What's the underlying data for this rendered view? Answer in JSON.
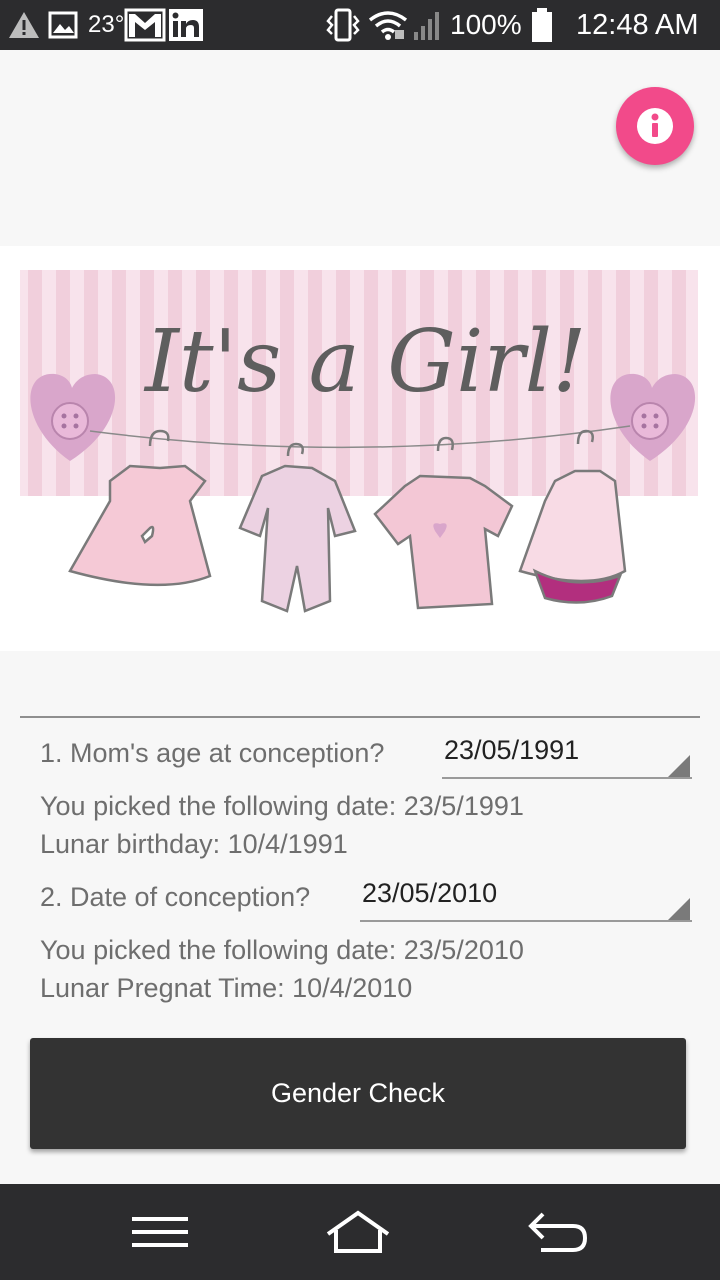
{
  "status_bar": {
    "temperature": "23°",
    "battery_percent": "100%",
    "time": "12:48 AM",
    "icons": [
      "warning-icon",
      "image-icon",
      "gmail-icon",
      "linkedin-icon",
      "vibrate-icon",
      "wifi-icon",
      "signal-icon",
      "battery-icon"
    ]
  },
  "info_button": {
    "icon": "info-icon",
    "color": "#f24a8a"
  },
  "banner": {
    "text": "It's a Girl!"
  },
  "form": {
    "q1": {
      "label": "1. Mom's age at conception?",
      "value": "23/05/1991",
      "picked": "You picked the following date: 23/5/1991",
      "lunar": "Lunar birthday: 10/4/1991"
    },
    "q2": {
      "label": "2. Date of conception?",
      "value": "23/05/2010",
      "picked": "You picked the following date: 23/5/2010",
      "lunar": "Lunar Pregnat Time: 10/4/2010"
    },
    "submit_label": "Gender Check"
  },
  "nav_bar": {
    "icons": [
      "menu-icon",
      "home-icon",
      "back-icon"
    ]
  }
}
